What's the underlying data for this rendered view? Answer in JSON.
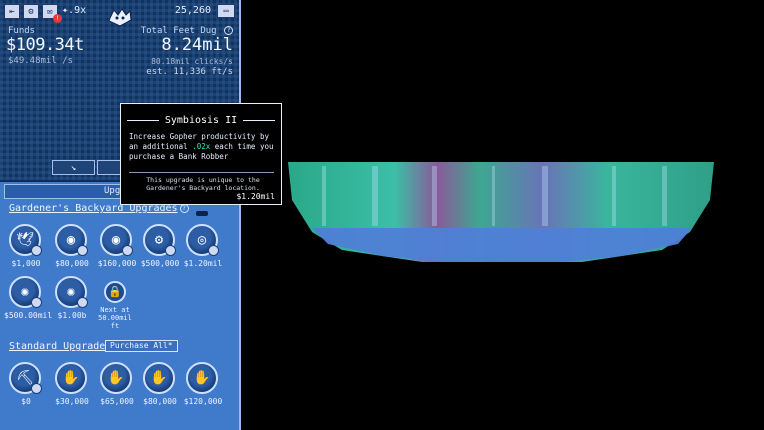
{
  "header": {
    "multiplier": "9x",
    "gold": "25,260"
  },
  "stats": {
    "funds_label": "Funds",
    "funds_value": "$109.34t",
    "funds_rate": "$49.48mil /s",
    "feet_label": "Total Feet Dug",
    "feet_value": "8.24mil",
    "clicks_rate": "80.18mil clicks/s",
    "est_rate": "est. 11,336 ft/s"
  },
  "upgrades_tab": "Upgr",
  "backyard": {
    "title": "Gardener's Backyard Upgrades",
    "items": [
      {
        "icon": "bird-icon",
        "cost": "$1,000"
      },
      {
        "icon": "gopher-group-icon",
        "cost": "$80,000"
      },
      {
        "icon": "gopher-group-icon",
        "cost": "$160,000"
      },
      {
        "icon": "gear-icon",
        "cost": "$500,000"
      },
      {
        "icon": "gopher-coin-icon",
        "cost": "$1.20mil"
      },
      {
        "icon": "sparkle-icon",
        "cost": "$500.00mil"
      },
      {
        "icon": "sparkle-icon",
        "cost": "$1.00b"
      }
    ],
    "locked_text": "Next at 50.00mil ft"
  },
  "standard": {
    "title": "Standard Upgrades",
    "purchase_all": "Purchase All*",
    "items": [
      {
        "icon": "shovel-icon",
        "cost": "$0"
      },
      {
        "icon": "gopher-icon",
        "cost": "$30,000"
      },
      {
        "icon": "gopher-icon",
        "cost": "$65,000"
      },
      {
        "icon": "gopher-icon",
        "cost": "$80,000"
      },
      {
        "icon": "gopher-icon",
        "cost": "$120,000"
      }
    ]
  },
  "tooltip": {
    "title": "Symbiosis II",
    "desc_1": "Increase Gopher productivity by an additional ",
    "desc_hl": ".02x",
    "desc_2": " each time you purchase a Bank Robber",
    "note": "This upgrade is unique to the Gardener's Backyard location.",
    "price": "$1.20mil"
  },
  "colors": {
    "panel_bg": "#10335f",
    "upgrades_bg": "#3f7acb",
    "highlight": "#39e6c6"
  }
}
